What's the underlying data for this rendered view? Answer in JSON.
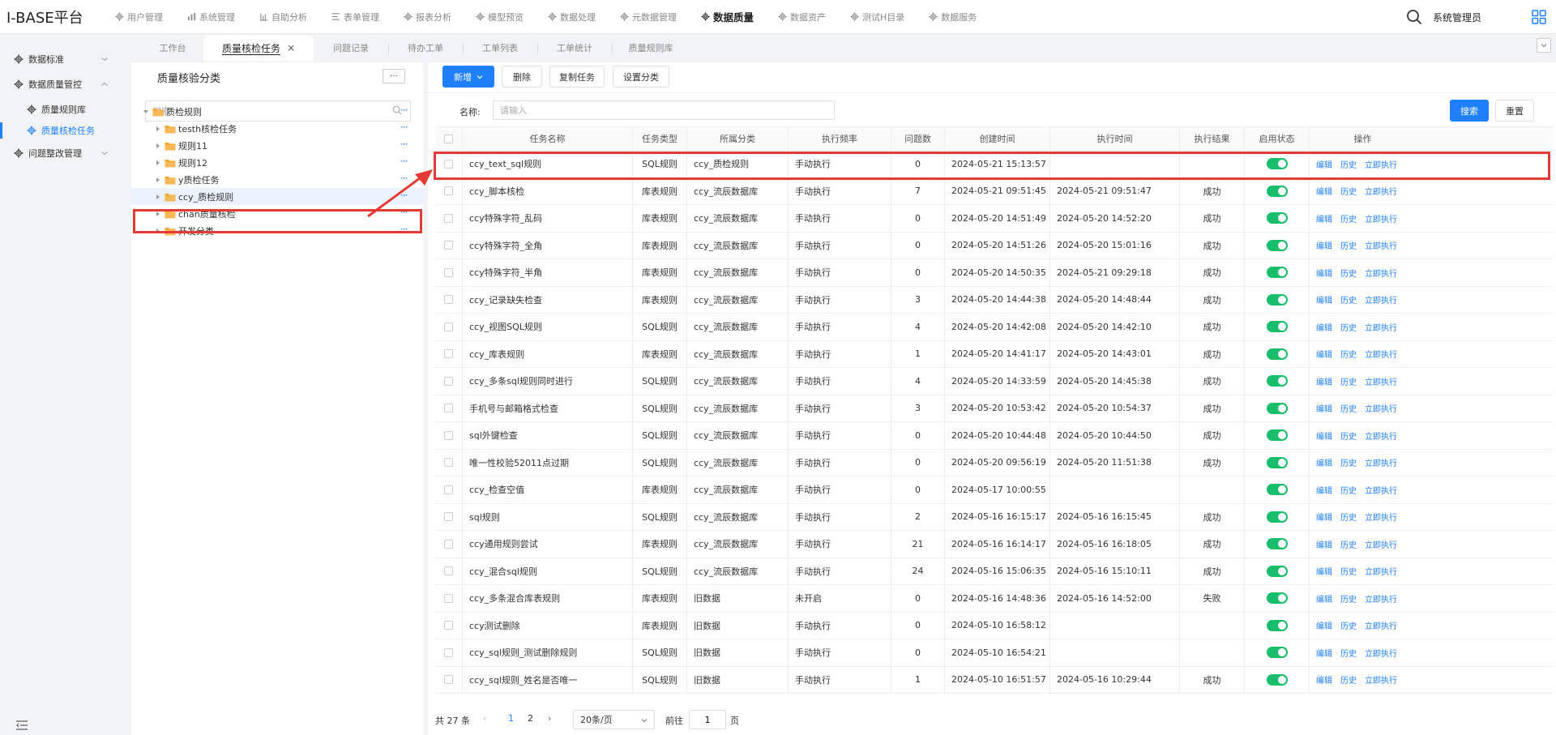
{
  "app": {
    "title": "I-BASE平台",
    "user": "系统管理员"
  },
  "topnav": [
    {
      "label": "用户管理",
      "icon": "gear-icon",
      "active": false
    },
    {
      "label": "系统管理",
      "icon": "bar-chart-icon",
      "active": false
    },
    {
      "label": "自助分析",
      "icon": "analytics-icon",
      "active": false
    },
    {
      "label": "表单管理",
      "icon": "form-icon",
      "active": false
    },
    {
      "label": "报表分析",
      "icon": "gear-icon",
      "active": false
    },
    {
      "label": "模型预览",
      "icon": "gear-icon",
      "active": false
    },
    {
      "label": "数据处理",
      "icon": "gear-icon",
      "active": false
    },
    {
      "label": "元数据管理",
      "icon": "gear-icon",
      "active": false
    },
    {
      "label": "数据质量",
      "icon": "gear-icon",
      "active": true
    },
    {
      "label": "数据资产",
      "icon": "gear-icon",
      "active": false
    },
    {
      "label": "测试H目录",
      "icon": "gear-icon",
      "active": false
    },
    {
      "label": "数据服务",
      "icon": "gear-icon",
      "active": false
    }
  ],
  "sidebar": {
    "items": [
      {
        "label": "数据标准",
        "level": 1,
        "expandable": true,
        "active": false
      },
      {
        "label": "数据质量管控",
        "level": 1,
        "expandable": true,
        "expanded": true,
        "active": false
      },
      {
        "label": "质量规则库",
        "level": 2,
        "expandable": false,
        "active": false
      },
      {
        "label": "质量核检任务",
        "level": 2,
        "expandable": false,
        "active": true
      },
      {
        "label": "问题整改管理",
        "level": 1,
        "expandable": true,
        "active": false
      }
    ]
  },
  "tabs": [
    {
      "label": "工作台",
      "active": false,
      "closable": false
    },
    {
      "label": "质量核检任务",
      "active": true,
      "closable": true
    },
    {
      "label": "问题记录",
      "active": false,
      "closable": false
    },
    {
      "label": "待办工单",
      "active": false,
      "closable": false
    },
    {
      "label": "工单列表",
      "active": false,
      "closable": false
    },
    {
      "label": "工单统计",
      "active": false,
      "closable": false
    },
    {
      "label": "质量规则库",
      "active": false,
      "closable": false
    }
  ],
  "tree": {
    "title": "质量核验分类",
    "more_label": "···",
    "search_placeholder": "搜索",
    "nodes": [
      {
        "label": "质检规则",
        "level": 0,
        "expanded": true,
        "selected": false
      },
      {
        "label": "testh核检任务",
        "level": 1,
        "expanded": false,
        "selected": false
      },
      {
        "label": "规则11",
        "level": 1,
        "expanded": false,
        "selected": false
      },
      {
        "label": "规则12",
        "level": 1,
        "expanded": false,
        "selected": false
      },
      {
        "label": "y质检任务",
        "level": 1,
        "expanded": false,
        "selected": false
      },
      {
        "label": "ccy_质检规则",
        "level": 1,
        "expanded": false,
        "selected": true
      },
      {
        "label": "chan质量核检",
        "level": 1,
        "expanded": false,
        "selected": false
      },
      {
        "label": "开发分类",
        "level": 1,
        "expanded": false,
        "selected": false
      }
    ]
  },
  "toolbar": {
    "new_label": "新增",
    "delete_label": "删除",
    "copy_label": "复制任务",
    "set_category_label": "设置分类"
  },
  "filter": {
    "name_label": "名称:",
    "name_placeholder": "请输入",
    "search_label": "搜索",
    "reset_label": "重置"
  },
  "table": {
    "columns": [
      "任务名称",
      "任务类型",
      "所属分类",
      "执行频率",
      "问题数",
      "创建时间",
      "执行时间",
      "执行结果",
      "启用状态",
      "操作"
    ],
    "actions": [
      "编辑",
      "历史",
      "立即执行"
    ],
    "rows": [
      {
        "name": "ccy_text_sql规则",
        "type": "SQL规则",
        "category": "ccy_质检规则",
        "freq": "手动执行",
        "issues": "0",
        "created": "2024-05-21 15:13:57",
        "executed": "",
        "result": "",
        "enabled": true
      },
      {
        "name": "ccy_脚本核检",
        "type": "库表规则",
        "category": "ccy_流辰数据库",
        "freq": "手动执行",
        "issues": "7",
        "created": "2024-05-21 09:51:45",
        "executed": "2024-05-21 09:51:47",
        "result": "成功",
        "enabled": true
      },
      {
        "name": "ccy特殊字符_乱码",
        "type": "库表规则",
        "category": "ccy_流辰数据库",
        "freq": "手动执行",
        "issues": "0",
        "created": "2024-05-20 14:51:49",
        "executed": "2024-05-20 14:52:20",
        "result": "成功",
        "enabled": true
      },
      {
        "name": "ccy特殊字符_全角",
        "type": "库表规则",
        "category": "ccy_流辰数据库",
        "freq": "手动执行",
        "issues": "0",
        "created": "2024-05-20 14:51:26",
        "executed": "2024-05-20 15:01:16",
        "result": "成功",
        "enabled": true
      },
      {
        "name": "ccy特殊字符_半角",
        "type": "库表规则",
        "category": "ccy_流辰数据库",
        "freq": "手动执行",
        "issues": "0",
        "created": "2024-05-20 14:50:35",
        "executed": "2024-05-21 09:29:18",
        "result": "成功",
        "enabled": true
      },
      {
        "name": "ccy_记录缺失检查",
        "type": "库表规则",
        "category": "ccy_流辰数据库",
        "freq": "手动执行",
        "issues": "3",
        "created": "2024-05-20 14:44:38",
        "executed": "2024-05-20 14:48:44",
        "result": "成功",
        "enabled": true
      },
      {
        "name": "ccy_视图SQL规则",
        "type": "SQL规则",
        "category": "ccy_流辰数据库",
        "freq": "手动执行",
        "issues": "4",
        "created": "2024-05-20 14:42:08",
        "executed": "2024-05-20 14:42:10",
        "result": "成功",
        "enabled": true
      },
      {
        "name": "ccy_库表规则",
        "type": "库表规则",
        "category": "ccy_流辰数据库",
        "freq": "手动执行",
        "issues": "1",
        "created": "2024-05-20 14:41:17",
        "executed": "2024-05-20 14:43:01",
        "result": "成功",
        "enabled": true
      },
      {
        "name": "ccy_多条sql规则同时进行",
        "type": "SQL规则",
        "category": "ccy_流辰数据库",
        "freq": "手动执行",
        "issues": "4",
        "created": "2024-05-20 14:33:59",
        "executed": "2024-05-20 14:45:38",
        "result": "成功",
        "enabled": true
      },
      {
        "name": "手机号与邮箱格式检查",
        "type": "SQL规则",
        "category": "ccy_流辰数据库",
        "freq": "手动执行",
        "issues": "3",
        "created": "2024-05-20 10:53:42",
        "executed": "2024-05-20 10:54:37",
        "result": "成功",
        "enabled": true
      },
      {
        "name": "sql外键检查",
        "type": "SQL规则",
        "category": "ccy_流辰数据库",
        "freq": "手动执行",
        "issues": "0",
        "created": "2024-05-20 10:44:48",
        "executed": "2024-05-20 10:44:50",
        "result": "成功",
        "enabled": true
      },
      {
        "name": "唯一性校验52011点过期",
        "type": "SQL规则",
        "category": "ccy_流辰数据库",
        "freq": "手动执行",
        "issues": "0",
        "created": "2024-05-20 09:56:19",
        "executed": "2024-05-20 11:51:38",
        "result": "成功",
        "enabled": true
      },
      {
        "name": "ccy_检查空值",
        "type": "库表规则",
        "category": "ccy_流辰数据库",
        "freq": "手动执行",
        "issues": "0",
        "created": "2024-05-17 10:00:55",
        "executed": "",
        "result": "",
        "enabled": true
      },
      {
        "name": "sql规则",
        "type": "SQL规则",
        "category": "ccy_流辰数据库",
        "freq": "手动执行",
        "issues": "2",
        "created": "2024-05-16 16:15:17",
        "executed": "2024-05-16 16:15:45",
        "result": "成功",
        "enabled": true
      },
      {
        "name": "ccy通用规则尝试",
        "type": "库表规则",
        "category": "ccy_流辰数据库",
        "freq": "手动执行",
        "issues": "21",
        "created": "2024-05-16 16:14:17",
        "executed": "2024-05-16 16:18:05",
        "result": "成功",
        "enabled": true
      },
      {
        "name": "ccy_混合sql规则",
        "type": "SQL规则",
        "category": "ccy_流辰数据库",
        "freq": "手动执行",
        "issues": "24",
        "created": "2024-05-16 15:06:35",
        "executed": "2024-05-16 15:10:11",
        "result": "成功",
        "enabled": true
      },
      {
        "name": "ccy_多条混合库表规则",
        "type": "库表规则",
        "category": "旧数据",
        "freq": "未开启",
        "issues": "0",
        "created": "2024-05-16 14:48:36",
        "executed": "2024-05-16 14:52:00",
        "result": "失败",
        "enabled": true
      },
      {
        "name": "ccy测试删除",
        "type": "库表规则",
        "category": "旧数据",
        "freq": "手动执行",
        "issues": "0",
        "created": "2024-05-10 16:58:12",
        "executed": "",
        "result": "",
        "enabled": true
      },
      {
        "name": "ccy_sql规则_测试删除规则",
        "type": "SQL规则",
        "category": "旧数据",
        "freq": "手动执行",
        "issues": "0",
        "created": "2024-05-10 16:54:21",
        "executed": "",
        "result": "",
        "enabled": true
      },
      {
        "name": "ccy_sql规则_姓名是否唯一",
        "type": "SQL规则",
        "category": "旧数据",
        "freq": "手动执行",
        "issues": "1",
        "created": "2024-05-10 16:51:57",
        "executed": "2024-05-16 10:29:44",
        "result": "成功",
        "enabled": true
      }
    ]
  },
  "pagination": {
    "total_text": "共 27 条",
    "pages": [
      "1",
      "2"
    ],
    "current_page": "1",
    "page_size_text": "20条/页",
    "goto_label": "前往",
    "goto_value": "1",
    "page_suffix": "页"
  },
  "colors": {
    "accent": "#1e80ff",
    "toggle_on": "#19be6b",
    "highlight": "#e53935",
    "folder": "#f5a623"
  }
}
